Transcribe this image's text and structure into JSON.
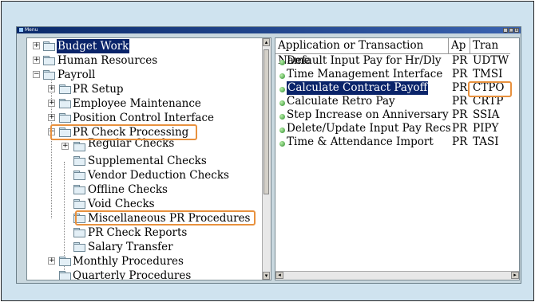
{
  "window": {
    "title": "Menu",
    "buttons": [
      "_",
      "□",
      "x"
    ]
  },
  "tree": [
    {
      "label": "Budget Work",
      "expander": "+",
      "selected": true
    },
    {
      "label": "Human Resources",
      "expander": "+"
    },
    {
      "label": "Payroll",
      "expander": "−"
    },
    {
      "label": "PR Setup",
      "expander": "+"
    },
    {
      "label": "Employee Maintenance",
      "expander": "+"
    },
    {
      "label": "Position Control Interface",
      "expander": "+"
    },
    {
      "label": "PR Check Processing",
      "expander": "−",
      "highlighted": true
    },
    {
      "label": "Regular Checks",
      "expander": "+"
    },
    {
      "label": "Supplemental Checks"
    },
    {
      "label": "Vendor Deduction Checks"
    },
    {
      "label": "Offline Checks"
    },
    {
      "label": "Void Checks"
    },
    {
      "label": "Miscellaneous PR Procedures",
      "highlighted": true
    },
    {
      "label": "PR Check Reports"
    },
    {
      "label": "Salary Transfer"
    },
    {
      "label": "Monthly Procedures",
      "expander": "+"
    },
    {
      "label": "Quarterly Procedures"
    }
  ],
  "table": {
    "headers": {
      "name": "Application or Transaction Name",
      "ap": "Ap",
      "tran": "Tran"
    },
    "rows": [
      {
        "name": "Default Input Pay for Hr/Dly",
        "ap": "PR",
        "tran": "UDTW"
      },
      {
        "name": "Time Management Interface",
        "ap": "PR",
        "tran": "TMSI"
      },
      {
        "name": "Calculate Contract Payoff",
        "ap": "PR",
        "tran": "CTPO",
        "selected": true,
        "highlighted": true
      },
      {
        "name": "Calculate Retro Pay",
        "ap": "PR",
        "tran": "CRTP"
      },
      {
        "name": "Step Increase on Anniversary",
        "ap": "PR",
        "tran": "SSIA"
      },
      {
        "name": "Delete/Update Input Pay Recs",
        "ap": "PR",
        "tran": "PIPY"
      },
      {
        "name": "Time & Attendance Import",
        "ap": "PR",
        "tran": "TASI"
      }
    ]
  },
  "colors": {
    "highlight": "#e8913e",
    "selection": "#0a246a",
    "background": "#cfe3ef"
  }
}
